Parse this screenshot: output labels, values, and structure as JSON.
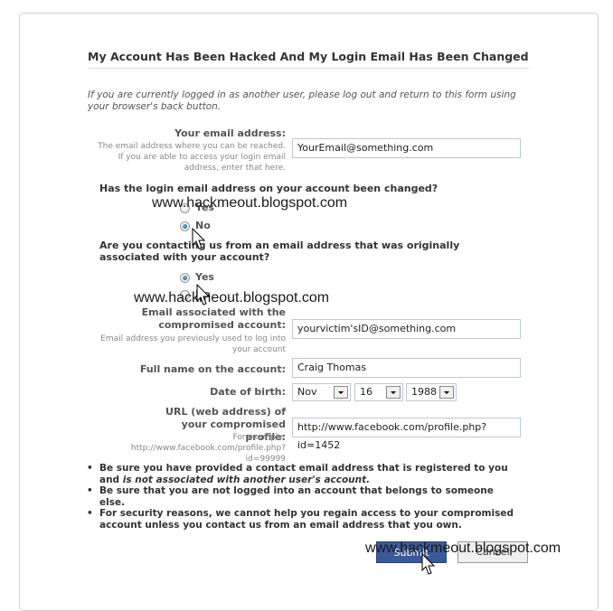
{
  "form": {
    "title": "My Account Has Been Hacked And My Login Email Has Been Changed",
    "intro": "If you are currently logged in as another user, please log out and return to this form using your browser's back button."
  },
  "email_field": {
    "label": "Your email address:",
    "help": "The email address where you can be reached. If you are able to access your login email address, enter that here.",
    "value": "YourEmail@something.com"
  },
  "question_changed": {
    "text": "Has the login email address on your account been changed?",
    "options": [
      {
        "label": "Yes",
        "selected": false
      },
      {
        "label": "No",
        "selected": true
      }
    ]
  },
  "question_original": {
    "text": "Are you contacting us from an email address that was originally associated with your account?",
    "options": [
      {
        "label": "Yes",
        "selected": true
      },
      {
        "label": "No",
        "selected": false
      }
    ]
  },
  "compromised_email": {
    "label": "Email associated with the compromised account:",
    "help": "Email address you previously used to log into your account",
    "value": "yourvictim'sID@something.com"
  },
  "full_name": {
    "label": "Full name on the account:",
    "value": "Craig Thomas"
  },
  "dob": {
    "label": "Date of birth:",
    "month": "Nov",
    "day": "16",
    "year": "1988"
  },
  "profile_url": {
    "label": "URL (web address) of your compromised profile:",
    "help": "For example, http://www.facebook.com/profile.php?id=99999",
    "value": "http://www.facebook.com/profile.php?id=1452"
  },
  "notes": [
    {
      "text": "Be sure you have provided a contact email address that is registered to you and ",
      "emphasis": "is not associated with another user's account."
    },
    {
      "text": "Be sure that you are not logged into an account that belongs to someone else.",
      "emphasis": ""
    },
    {
      "text": "For security reasons, we cannot help you regain access to your compromised account unless you contact us from an email address that you own.",
      "emphasis": ""
    }
  ],
  "buttons": {
    "submit": "Submit",
    "cancel": "Cancel"
  },
  "watermark": "www.hackmeout.blogspot.com",
  "colors": {
    "submit_bg": "#3b5998",
    "input_border": "#bdc7d8"
  }
}
